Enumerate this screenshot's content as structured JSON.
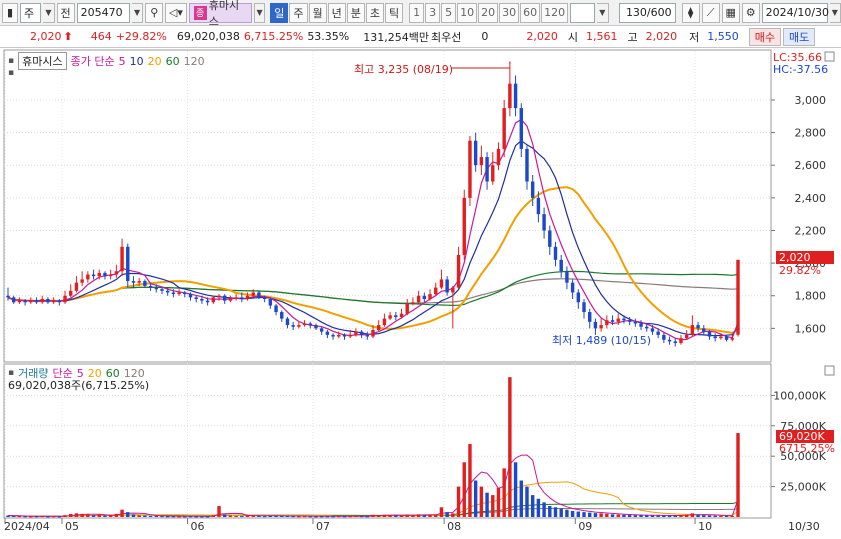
{
  "toolbar": {
    "market_select": "주",
    "type_label": "전",
    "code": "205470",
    "stock_name": "휴마시스",
    "name_tag": "종",
    "periods": [
      "일",
      "주",
      "월",
      "년",
      "분",
      "초",
      "틱"
    ],
    "active_period": "일",
    "minute_units": [
      "1",
      "3",
      "5",
      "10",
      "20",
      "30",
      "60",
      "120"
    ],
    "count": "130/600",
    "date": "2024/10/30"
  },
  "quote": {
    "price": "2,020",
    "change": "464",
    "change_pct": "+29.82%",
    "volume": "69,020,038",
    "volume_ratio": "6,715.25%",
    "turnover_pct": "53.35%",
    "amount": "131,254백만",
    "pref_label": "최우선",
    "pref_value": "0",
    "best_ask": "2,020",
    "open_label": "시",
    "open": "1,561",
    "high_label": "고",
    "high": "2,020",
    "low_label": "저",
    "low": "1,550",
    "buy_label": "매수",
    "sell_label": "매도"
  },
  "price_pane": {
    "legend_name": "휴마시스",
    "legend_type": "종가 단순",
    "ma_periods": [
      "5",
      "10",
      "20",
      "60",
      "120"
    ],
    "lc": "LC:35.66",
    "hc": "HC:-37.56",
    "high_note": "최고 3,235 (08/19)",
    "low_note": "최저 1,489 (10/15)",
    "price_tag": "2,020",
    "pct_tag": "29.82%"
  },
  "volume_pane": {
    "legend_name": "거래량",
    "legend_type": "단순",
    "ma_periods": [
      "5",
      "20",
      "60",
      "120"
    ],
    "value_line": "69,020,038주(6,715.25%)",
    "vol_tag": "69,020K",
    "vol_pct_tag": "6715.25%"
  },
  "x_axis": {
    "labels": [
      "2024/04",
      "05",
      "06",
      "07",
      "08",
      "09",
      "10"
    ],
    "last_label": "10/30"
  },
  "chart_data": {
    "type": "candlestick",
    "price_axis_ticks": [
      1600,
      1800,
      2000,
      2200,
      2400,
      2600,
      2800,
      3000
    ],
    "price_axis_labels": [
      "1,600",
      "1,800",
      "2,000",
      "2,200",
      "2,400",
      "2,600",
      "2,800",
      "3,000"
    ],
    "price_range": [
      1400,
      3300
    ],
    "volume_axis_ticks": [
      25000,
      50000,
      75000,
      100000
    ],
    "volume_axis_labels": [
      "25,000K",
      "50,000K",
      "75,000K",
      "100,000K"
    ],
    "volume_range": [
      0,
      125000
    ],
    "colors": {
      "up": "#e02020",
      "down": "#1d48c8",
      "ma5": "#c8189c",
      "ma10": "#1f2f9a",
      "ma20": "#f0a000",
      "ma60": "#1a7a2a",
      "ma120": "#8a7a7a"
    },
    "candles": [
      [
        1800,
        1790,
        1850,
        1770,
        1200
      ],
      [
        1790,
        1760,
        1800,
        1750,
        900
      ],
      [
        1760,
        1770,
        1790,
        1750,
        700
      ],
      [
        1770,
        1760,
        1780,
        1740,
        600
      ],
      [
        1760,
        1770,
        1790,
        1750,
        500
      ],
      [
        1770,
        1760,
        1790,
        1750,
        600
      ],
      [
        1760,
        1780,
        1800,
        1750,
        700
      ],
      [
        1780,
        1760,
        1790,
        1750,
        500
      ],
      [
        1760,
        1770,
        1790,
        1750,
        600
      ],
      [
        1770,
        1760,
        1780,
        1740,
        500
      ],
      [
        1760,
        1800,
        1830,
        1750,
        1500
      ],
      [
        1800,
        1830,
        1870,
        1790,
        2500
      ],
      [
        1830,
        1880,
        1920,
        1820,
        3000
      ],
      [
        1880,
        1900,
        1950,
        1860,
        2600
      ],
      [
        1900,
        1930,
        1950,
        1880,
        2000
      ],
      [
        1930,
        1920,
        1960,
        1900,
        1500
      ],
      [
        1920,
        1940,
        1960,
        1900,
        1800
      ],
      [
        1940,
        1920,
        1950,
        1900,
        1200
      ],
      [
        1920,
        1930,
        1960,
        1900,
        1500
      ],
      [
        1930,
        1950,
        1990,
        1910,
        2600
      ],
      [
        1950,
        2100,
        2150,
        1920,
        6000
      ],
      [
        2100,
        1890,
        2120,
        1850,
        4000
      ],
      [
        1890,
        1880,
        1920,
        1850,
        2000
      ],
      [
        1880,
        1890,
        1910,
        1860,
        1200
      ],
      [
        1890,
        1860,
        1900,
        1850,
        1100
      ],
      [
        1860,
        1850,
        1880,
        1830,
        900
      ],
      [
        1850,
        1840,
        1870,
        1820,
        800
      ],
      [
        1840,
        1830,
        1850,
        1810,
        700
      ],
      [
        1830,
        1820,
        1850,
        1800,
        600
      ],
      [
        1820,
        1810,
        1840,
        1790,
        600
      ],
      [
        1810,
        1820,
        1840,
        1800,
        500
      ],
      [
        1820,
        1810,
        1830,
        1790,
        500
      ],
      [
        1810,
        1790,
        1820,
        1770,
        600
      ],
      [
        1790,
        1780,
        1800,
        1760,
        500
      ],
      [
        1780,
        1770,
        1800,
        1750,
        500
      ],
      [
        1770,
        1760,
        1790,
        1740,
        500
      ],
      [
        1760,
        1790,
        1800,
        1750,
        1500
      ],
      [
        1790,
        1800,
        1810,
        1770,
        9000
      ],
      [
        1800,
        1770,
        1810,
        1750,
        2000
      ],
      [
        1770,
        1780,
        1800,
        1760,
        1200
      ],
      [
        1780,
        1790,
        1810,
        1770,
        900
      ],
      [
        1790,
        1780,
        1820,
        1760,
        800
      ],
      [
        1780,
        1800,
        1820,
        1770,
        1500
      ],
      [
        1800,
        1820,
        1840,
        1790,
        1200
      ],
      [
        1820,
        1790,
        1830,
        1780,
        1000
      ],
      [
        1790,
        1780,
        1800,
        1760,
        700
      ],
      [
        1780,
        1740,
        1790,
        1720,
        900
      ],
      [
        1740,
        1700,
        1750,
        1680,
        1000
      ],
      [
        1700,
        1660,
        1710,
        1640,
        900
      ],
      [
        1660,
        1620,
        1670,
        1600,
        800
      ],
      [
        1620,
        1610,
        1640,
        1590,
        700
      ],
      [
        1610,
        1620,
        1640,
        1600,
        600
      ],
      [
        1620,
        1630,
        1650,
        1610,
        700
      ],
      [
        1630,
        1620,
        1640,
        1600,
        600
      ],
      [
        1620,
        1600,
        1630,
        1590,
        500
      ],
      [
        1600,
        1580,
        1610,
        1560,
        600
      ],
      [
        1580,
        1560,
        1590,
        1540,
        600
      ],
      [
        1560,
        1550,
        1570,
        1530,
        600
      ],
      [
        1550,
        1560,
        1580,
        1540,
        700
      ],
      [
        1560,
        1550,
        1570,
        1530,
        600
      ],
      [
        1550,
        1560,
        1590,
        1540,
        700
      ],
      [
        1560,
        1580,
        1600,
        1550,
        800
      ],
      [
        1580,
        1560,
        1590,
        1540,
        700
      ],
      [
        1560,
        1550,
        1580,
        1530,
        600
      ],
      [
        1550,
        1590,
        1620,
        1540,
        1800
      ],
      [
        1590,
        1620,
        1650,
        1580,
        1500
      ],
      [
        1620,
        1660,
        1690,
        1610,
        1800
      ],
      [
        1660,
        1680,
        1700,
        1650,
        1500
      ],
      [
        1680,
        1670,
        1700,
        1650,
        1200
      ],
      [
        1670,
        1690,
        1720,
        1660,
        1200
      ],
      [
        1690,
        1750,
        1780,
        1680,
        2000
      ],
      [
        1750,
        1760,
        1790,
        1740,
        1700
      ],
      [
        1760,
        1800,
        1830,
        1750,
        2200
      ],
      [
        1800,
        1780,
        1820,
        1760,
        1500
      ],
      [
        1780,
        1810,
        1840,
        1770,
        1600
      ],
      [
        1810,
        1850,
        1880,
        1800,
        2000
      ],
      [
        1850,
        1900,
        1960,
        1840,
        8000
      ],
      [
        1900,
        1820,
        1920,
        1800,
        4000
      ],
      [
        1820,
        1850,
        1860,
        1600,
        3000
      ],
      [
        1850,
        2050,
        2100,
        1840,
        25000
      ],
      [
        2050,
        2400,
        2450,
        2020,
        45000
      ],
      [
        2400,
        2750,
        2780,
        2350,
        60000
      ],
      [
        2750,
        2600,
        2800,
        2560,
        30000
      ],
      [
        2600,
        2650,
        2720,
        2540,
        25000
      ],
      [
        2650,
        2500,
        2680,
        2450,
        20000
      ],
      [
        2500,
        2600,
        2680,
        2480,
        18000
      ],
      [
        2600,
        2700,
        2740,
        2570,
        24000
      ],
      [
        2700,
        2950,
        3000,
        2650,
        40000
      ],
      [
        2950,
        3100,
        3235,
        2900,
        115000
      ],
      [
        3100,
        2950,
        3150,
        2900,
        45000
      ],
      [
        2950,
        2700,
        2980,
        2650,
        30000
      ],
      [
        2700,
        2500,
        2720,
        2450,
        25000
      ],
      [
        2500,
        2400,
        2540,
        2350,
        18000
      ],
      [
        2400,
        2300,
        2440,
        2250,
        15000
      ],
      [
        2300,
        2200,
        2340,
        2150,
        12000
      ],
      [
        2200,
        2100,
        2230,
        2050,
        9000
      ],
      [
        2100,
        2020,
        2130,
        1980,
        8000
      ],
      [
        2020,
        1950,
        2050,
        1910,
        7000
      ],
      [
        1950,
        1880,
        1980,
        1840,
        6000
      ],
      [
        1880,
        1820,
        1900,
        1780,
        5000
      ],
      [
        1820,
        1760,
        1840,
        1720,
        4500
      ],
      [
        1760,
        1700,
        1780,
        1660,
        4000
      ],
      [
        1700,
        1640,
        1720,
        1600,
        3600
      ],
      [
        1640,
        1600,
        1660,
        1560,
        3200
      ],
      [
        1600,
        1620,
        1660,
        1580,
        3000
      ],
      [
        1620,
        1650,
        1680,
        1600,
        2600
      ],
      [
        1650,
        1640,
        1680,
        1620,
        2200
      ],
      [
        1640,
        1660,
        1690,
        1620,
        2000
      ],
      [
        1660,
        1650,
        1680,
        1630,
        1800
      ],
      [
        1650,
        1640,
        1670,
        1620,
        1600
      ],
      [
        1640,
        1630,
        1660,
        1610,
        1500
      ],
      [
        1630,
        1610,
        1650,
        1590,
        1500
      ],
      [
        1610,
        1600,
        1630,
        1580,
        1400
      ],
      [
        1600,
        1580,
        1620,
        1560,
        1300
      ],
      [
        1580,
        1560,
        1600,
        1540,
        1200
      ],
      [
        1560,
        1530,
        1580,
        1510,
        1200
      ],
      [
        1530,
        1520,
        1550,
        1500,
        1100
      ],
      [
        1520,
        1510,
        1540,
        1489,
        1200
      ],
      [
        1510,
        1540,
        1560,
        1500,
        1500
      ],
      [
        1540,
        1560,
        1590,
        1530,
        1800
      ],
      [
        1560,
        1620,
        1680,
        1550,
        3000
      ],
      [
        1620,
        1600,
        1640,
        1580,
        2000
      ],
      [
        1600,
        1580,
        1620,
        1560,
        1500
      ],
      [
        1580,
        1550,
        1590,
        1530,
        1200
      ],
      [
        1550,
        1540,
        1570,
        1520,
        1100
      ],
      [
        1540,
        1550,
        1570,
        1530,
        1000
      ],
      [
        1550,
        1530,
        1560,
        1520,
        900
      ],
      [
        1530,
        1540,
        1560,
        1520,
        900
      ],
      [
        1561,
        2020,
        2020,
        1550,
        69020
      ]
    ]
  }
}
